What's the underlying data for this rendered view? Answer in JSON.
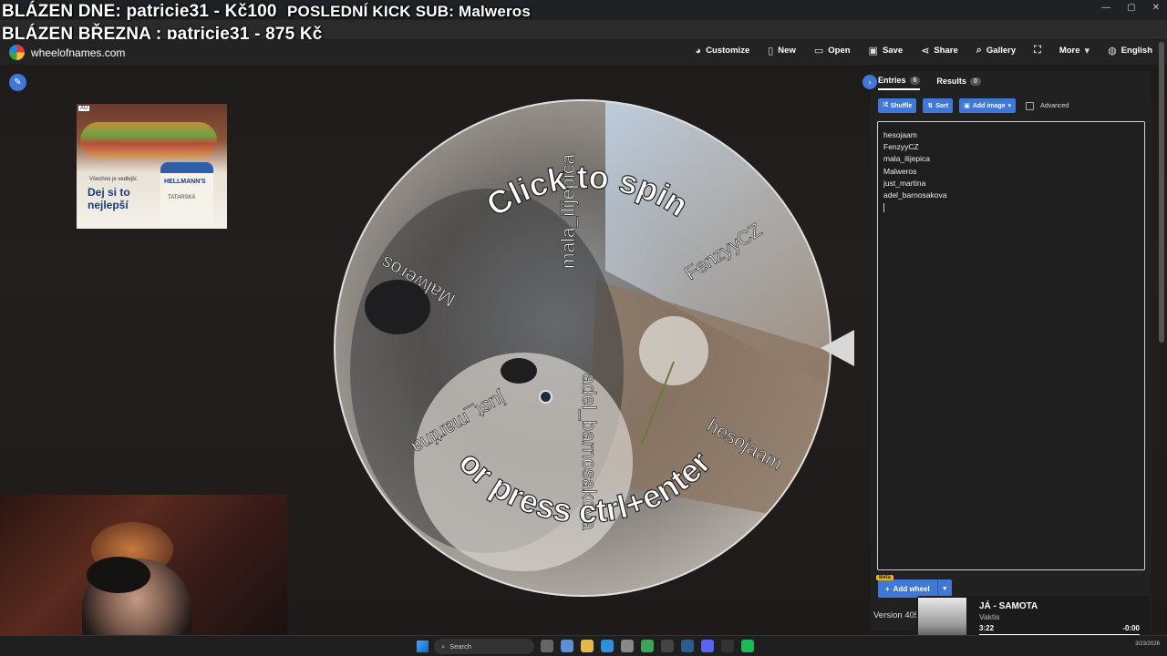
{
  "overlay": {
    "blazen_dne": "BLÁZEN DNE: patricie31 - Kč100",
    "blazen_brezna": "BLÁZEN BŘEZNA : patricie31 - 875 Kč",
    "posledni_sub": "POSLEDNÍ KICK SUB: Malweros"
  },
  "site": {
    "name": "wheelofnames.com"
  },
  "nav": {
    "customize": "Customize",
    "new": "New",
    "open": "Open",
    "save": "Save",
    "share": "Share",
    "gallery": "Gallery",
    "more": "More",
    "language": "English"
  },
  "ad": {
    "tag": "AD",
    "small_text": "Všechno je vedlejší.",
    "headline": "Dej si to nejlepší",
    "brand": "HELLMANN'S",
    "product": "TATARSKÁ"
  },
  "wheel": {
    "spin_text_top": "Click to spin",
    "spin_text_bottom": "or press ctrl+enter",
    "segments": [
      "hesojaam",
      "FenzyyCZ",
      "mala_ilijepica",
      "Malweros",
      "just_martina",
      "adel_barnosakova"
    ]
  },
  "panel": {
    "tab_entries": "Entries",
    "entries_count": "6",
    "tab_results": "Results",
    "results_count": "0",
    "shuffle": "Shuffle",
    "sort": "Sort",
    "add_image": "Add image",
    "advanced": "Advanced",
    "entries": [
      "hesojaam",
      "FenzyyCZ",
      "mala_ilijepica",
      "Malweros",
      "just_martina",
      "adel_barnosakova"
    ],
    "add_wheel": "Add wheel",
    "beta": "Beta",
    "version": "Version 405"
  },
  "music": {
    "title": "JÁ - SAMOTA",
    "artist": "Vaktis",
    "elapsed": "3:22",
    "remaining": "-0:00",
    "progress": 1.0
  },
  "taskbar": {
    "search_placeholder": "Search",
    "date": "3/23/2026"
  },
  "colors": {
    "accent": "#3f78d6",
    "panel_bg": "#212121"
  }
}
